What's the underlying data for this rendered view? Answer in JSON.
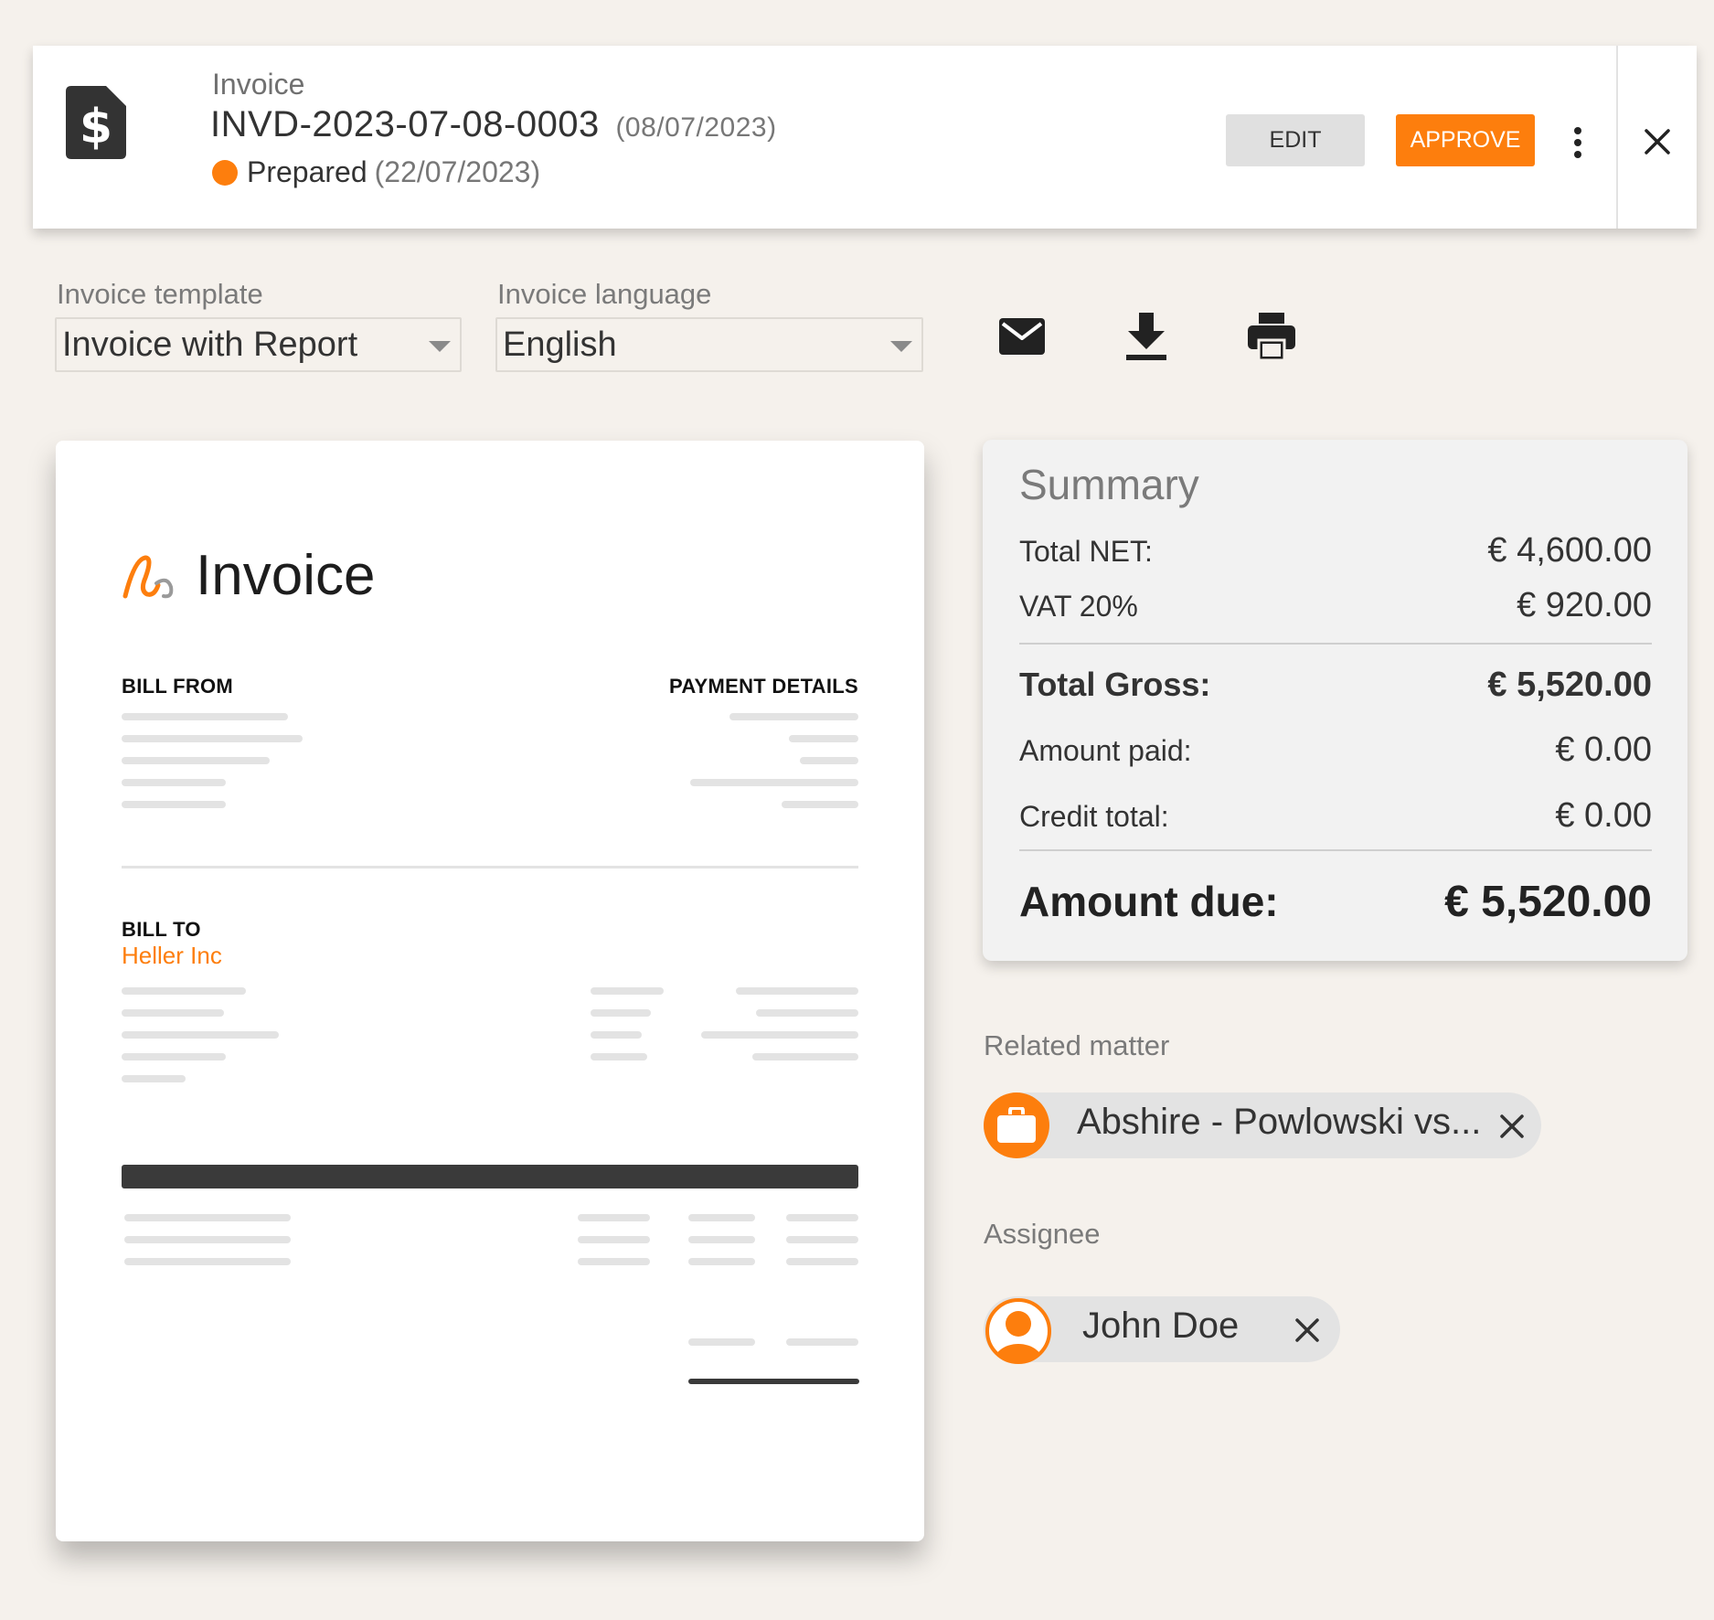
{
  "header": {
    "type_label": "Invoice",
    "invoice_number": "INVD-2023-07-08-0003",
    "invoice_date": "(08/07/2023)",
    "status": "Prepared",
    "status_date": "(22/07/2023)",
    "status_color": "#fd7e0d",
    "edit_label": "EDIT",
    "approve_label": "APPROVE"
  },
  "controls": {
    "template_label": "Invoice template",
    "template_value": "Invoice with Report",
    "language_label": "Invoice language",
    "language_value": "English",
    "icons": [
      "mail-icon",
      "download-icon",
      "print-icon"
    ]
  },
  "preview": {
    "title": "Invoice",
    "bill_from": "BILL FROM",
    "payment_details": "PAYMENT DETAILS",
    "bill_to": "BILL TO",
    "client": "Heller Inc"
  },
  "summary": {
    "title": "Summary",
    "rows": {
      "net_label": "Total NET:",
      "net_value": "€ 4,600.00",
      "vat_label": "VAT 20%",
      "vat_value": "€ 920.00",
      "gross_label": "Total Gross:",
      "gross_value": "€ 5,520.00",
      "paid_label": "Amount paid:",
      "paid_value": "€ 0.00",
      "credit_label": "Credit total:",
      "credit_value": "€ 0.00",
      "due_label": "Amount due:",
      "due_value": "€ 5,520.00"
    }
  },
  "related": {
    "label": "Related matter",
    "matter": "Abshire - Powlowski vs..."
  },
  "assignee": {
    "label": "Assignee",
    "name": "John Doe"
  },
  "accent_color": "#fd7e0d"
}
